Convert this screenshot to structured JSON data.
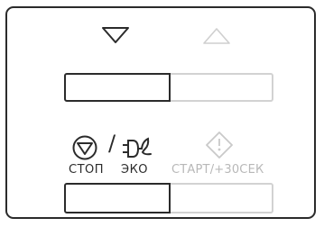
{
  "panel": {
    "arrows": {
      "down_icon": "triangle-down-icon",
      "up_icon": "triangle-up-icon"
    },
    "buttons": {
      "stop_label": "СТОП",
      "eco_label": "ЭКО",
      "start_label": "СТАРТ/+30СЕК",
      "separator": "/"
    },
    "icons": {
      "stop": "stop-icon",
      "eco": "eco-plug-icon",
      "start": "start-diamond-icon"
    },
    "colors": {
      "active": "#2b2b2b",
      "inactive": "#c9c9c9",
      "inactive_text": "#b8b8b8"
    }
  }
}
